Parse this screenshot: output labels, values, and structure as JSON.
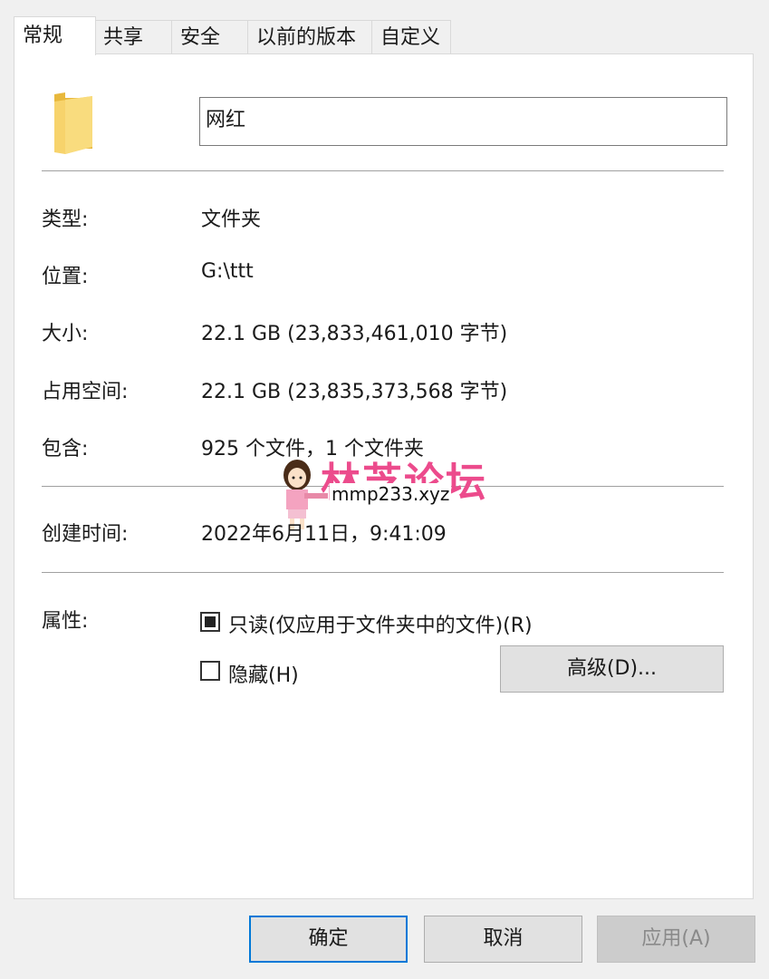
{
  "tabs": [
    {
      "label": "常规",
      "active": true
    },
    {
      "label": "共享"
    },
    {
      "label": "安全"
    },
    {
      "label": "以前的版本"
    },
    {
      "label": "自定义"
    }
  ],
  "folder": {
    "icon": "folder-icon",
    "name": "网红"
  },
  "properties": {
    "type": {
      "label": "类型:",
      "value": "文件夹"
    },
    "location": {
      "label": "位置:",
      "value": "G:\\ttt"
    },
    "size": {
      "label": "大小:",
      "value": "22.1 GB (23,833,461,010 字节)"
    },
    "size_on_disk": {
      "label": "占用空间:",
      "value": "22.1 GB (23,835,373,568 字节)"
    },
    "contains": {
      "label": "包含:",
      "value": "925 个文件，1 个文件夹"
    },
    "created": {
      "label": "创建时间:",
      "value": "2022年6月11日，9:41:09"
    }
  },
  "attributes": {
    "label": "属性:",
    "readonly": {
      "label": "只读(仅应用于文件夹中的文件)(R)",
      "state": "indeterminate"
    },
    "hidden": {
      "label": "隐藏(H)",
      "checked": false
    },
    "advanced_button": "高级(D)..."
  },
  "watermark": {
    "text": "林芝论坛",
    "url": "mmp233.xyz"
  },
  "buttons": {
    "ok": "确定",
    "cancel": "取消",
    "apply": "应用(A)"
  },
  "colors": {
    "accent": "#0078d7",
    "folder": "#f5c94c",
    "watermark": "#ec4b8c"
  }
}
